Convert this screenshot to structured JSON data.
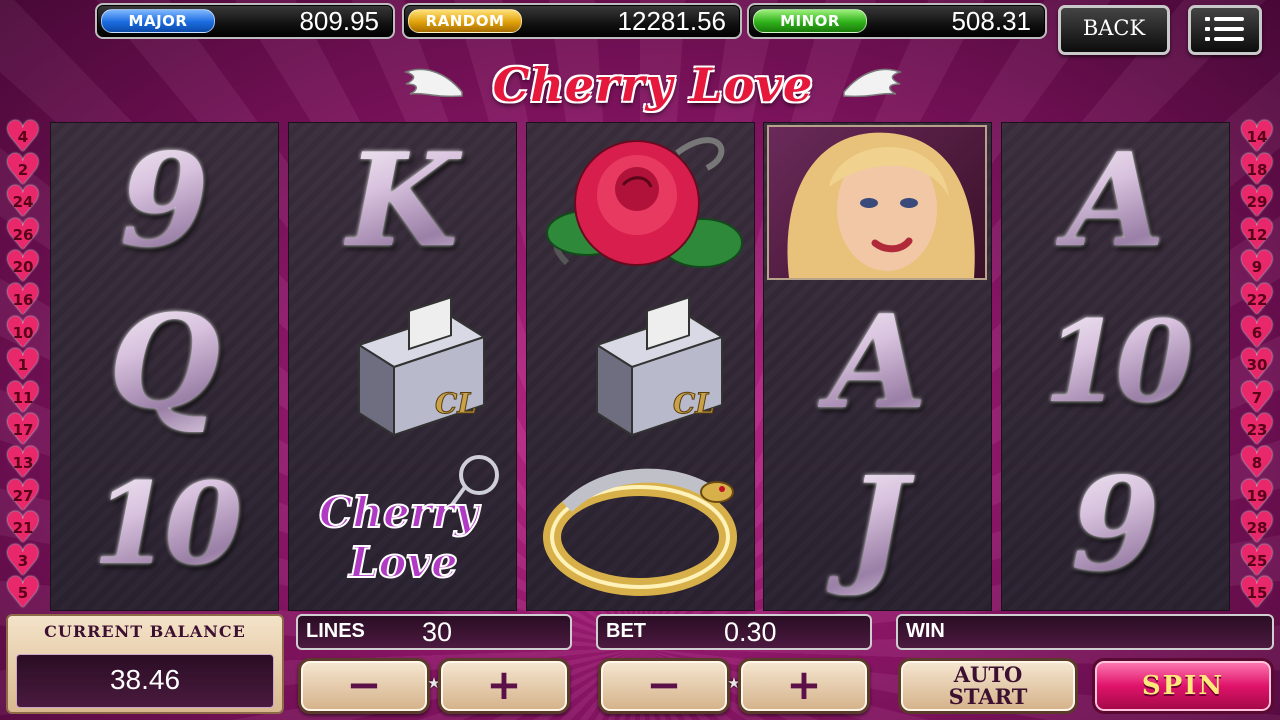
{
  "jackpots": {
    "major": {
      "label": "MAJOR",
      "value": "809.95",
      "color": "#1a6be0"
    },
    "random": {
      "label": "RANDOM",
      "value": "12281.56",
      "color": "#e0a10a"
    },
    "minor": {
      "label": "MINOR",
      "value": "508.31",
      "color": "#2fb21a"
    }
  },
  "header": {
    "back_label": "BACK",
    "menu_icon": "hamburger-menu-icon",
    "logo_text": "Cherry Love"
  },
  "paylines": {
    "left": [
      "4",
      "2",
      "24",
      "26",
      "20",
      "16",
      "10",
      "1",
      "11",
      "17",
      "13",
      "27",
      "21",
      "3",
      "5"
    ],
    "right": [
      "14",
      "18",
      "29",
      "12",
      "9",
      "22",
      "6",
      "30",
      "7",
      "23",
      "8",
      "19",
      "28",
      "25",
      "15"
    ],
    "marker_color": "#e8286a"
  },
  "reels": [
    {
      "symbols": [
        "9",
        "Q",
        "10"
      ]
    },
    {
      "symbols": [
        "K",
        "zippo-lighter-icon",
        "cherry-love-keychain-icon"
      ]
    },
    {
      "symbols": [
        "red-rose-icon",
        "zippo-lighter-icon",
        "snake-ring-icon"
      ]
    },
    {
      "symbols": [
        "blonde-woman-portrait",
        "A",
        "J"
      ]
    },
    {
      "symbols": [
        "A",
        "10",
        "9"
      ]
    }
  ],
  "keychain_text": {
    "line1": "Cherry",
    "line2": "Love"
  },
  "lighter_text": "CL",
  "panel": {
    "balance_label": "CURRENT BALANCE",
    "balance_value": "38.46",
    "lines_label": "LINES",
    "lines_value": "30",
    "bet_label": "BET",
    "bet_value": "0.30",
    "win_label": "WIN",
    "minus": "−",
    "plus": "+",
    "autostart_line1": "AUTO",
    "autostart_line2": "START",
    "spin_label": "SPIN"
  }
}
